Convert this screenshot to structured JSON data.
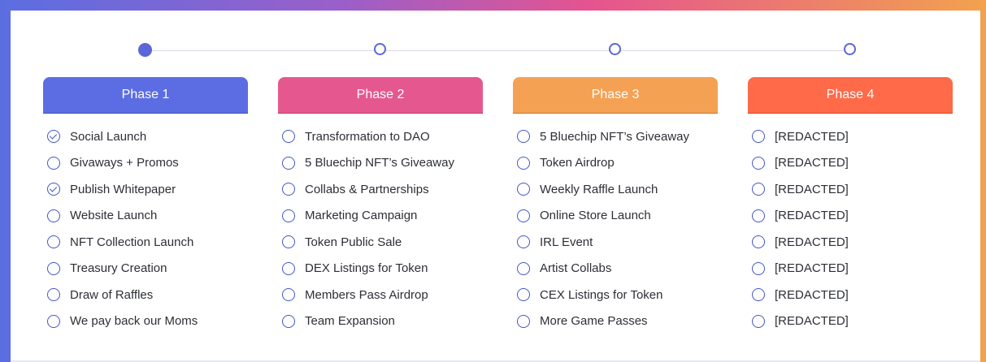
{
  "colors": {
    "accent": "#5a67d8",
    "phase1": "#5c6de4",
    "phase2": "#e5588f",
    "phase3": "#f5a154",
    "phase4": "#ff6a49"
  },
  "steps": [
    {
      "active": true
    },
    {
      "active": false
    },
    {
      "active": false
    },
    {
      "active": false
    }
  ],
  "phases": [
    {
      "title": "Phase 1",
      "items": [
        {
          "label": "Social Launch",
          "checked": true
        },
        {
          "label": "Givaways + Promos",
          "checked": false
        },
        {
          "label": "Publish Whitepaper",
          "checked": true
        },
        {
          "label": "Website Launch",
          "checked": false
        },
        {
          "label": "NFT Collection Launch",
          "checked": false
        },
        {
          "label": "Treasury Creation",
          "checked": false
        },
        {
          "label": "Draw of Raffles",
          "checked": false
        },
        {
          "label": "We pay back our Moms",
          "checked": false
        }
      ]
    },
    {
      "title": "Phase 2",
      "items": [
        {
          "label": "Transformation to DAO",
          "checked": false
        },
        {
          "label": "5 Bluechip NFT’s Giveaway",
          "checked": false
        },
        {
          "label": "Collabs & Partnerships",
          "checked": false
        },
        {
          "label": "Marketing Campaign",
          "checked": false
        },
        {
          "label": "Token Public Sale",
          "checked": false
        },
        {
          "label": "DEX Listings for Token",
          "checked": false
        },
        {
          "label": "Members Pass Airdrop",
          "checked": false
        },
        {
          "label": "Team Expansion",
          "checked": false
        }
      ]
    },
    {
      "title": "Phase 3",
      "items": [
        {
          "label": "5 Bluechip NFT’s Giveaway",
          "checked": false
        },
        {
          "label": "Token Airdrop",
          "checked": false
        },
        {
          "label": "Weekly Raffle Launch",
          "checked": false
        },
        {
          "label": "Online Store Launch",
          "checked": false
        },
        {
          "label": "IRL Event",
          "checked": false
        },
        {
          "label": "Artist Collabs",
          "checked": false
        },
        {
          "label": "CEX Listings for Token",
          "checked": false
        },
        {
          "label": "More Game Passes",
          "checked": false
        }
      ]
    },
    {
      "title": "Phase 4",
      "items": [
        {
          "label": "[REDACTED]",
          "checked": false
        },
        {
          "label": "[REDACTED]",
          "checked": false
        },
        {
          "label": "[REDACTED]",
          "checked": false
        },
        {
          "label": "[REDACTED]",
          "checked": false
        },
        {
          "label": "[REDACTED]",
          "checked": false
        },
        {
          "label": "[REDACTED]",
          "checked": false
        },
        {
          "label": "[REDACTED]",
          "checked": false
        },
        {
          "label": "[REDACTED]",
          "checked": false
        }
      ]
    }
  ]
}
